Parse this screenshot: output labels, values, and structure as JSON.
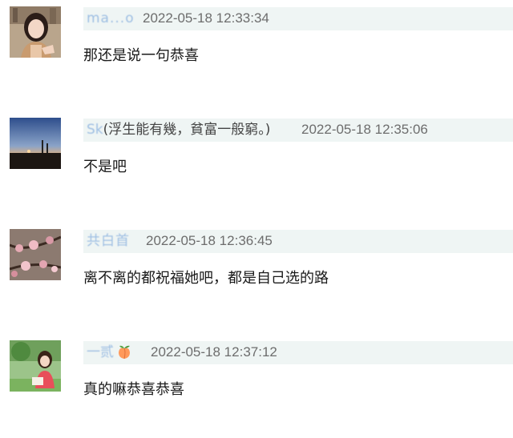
{
  "comments": [
    {
      "username": "ma...o",
      "timestamp": "2022-05-18 12:33:34",
      "text": "那还是说一句恭喜",
      "avatar": "woman-portrait"
    },
    {
      "username": "Sk",
      "username_tail": "(浮生能有幾，貧富一般窮。)",
      "timestamp": "2022-05-18 12:35:06",
      "text": "不是吧",
      "avatar": "sunset-landscape"
    },
    {
      "username": "共白首",
      "timestamp": "2022-05-18 12:36:45",
      "text": "离不离的都祝福她吧，都是自己选的路",
      "avatar": "blossom-branches"
    },
    {
      "username": "一贰",
      "timestamp": "2022-05-18 12:37:12",
      "text": "真的嘛恭喜恭喜",
      "avatar": "girl-with-book",
      "emoji": "peach-icon"
    }
  ],
  "colors": {
    "header_bg": "#eff5f4",
    "username": "#5b8fc7",
    "timestamp": "#6d6d6d",
    "text": "#1a1a1a"
  }
}
